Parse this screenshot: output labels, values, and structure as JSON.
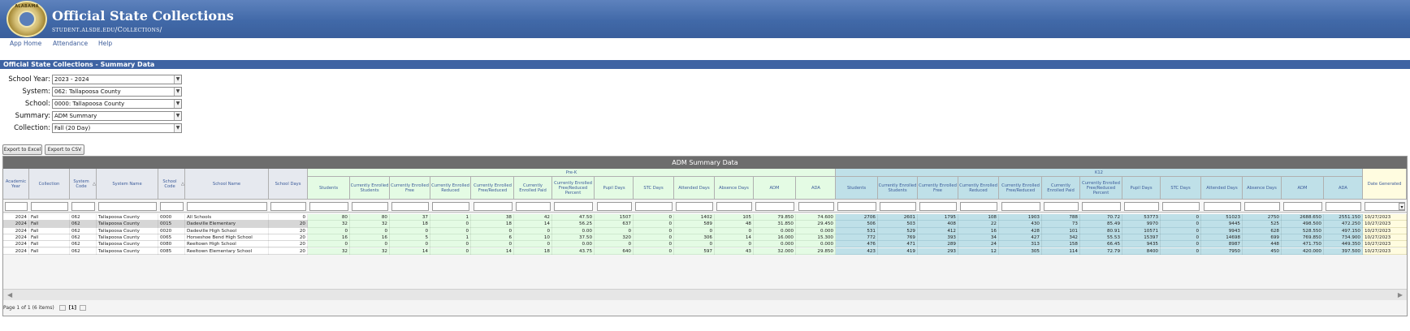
{
  "header": {
    "title": "Official State Collections",
    "subtitle": "student.alsde.edu/Collections/",
    "seal_text": "ALABAMA"
  },
  "nav": [
    "App Home",
    "Attendance",
    "Help"
  ],
  "section": {
    "title": "Official State Collections - Summary Data"
  },
  "filters": [
    {
      "label": "School Year:",
      "value": "2023 - 2024"
    },
    {
      "label": "System:",
      "value": "062: Tallapoosa County"
    },
    {
      "label": "School:",
      "value": "0000: Tallapoosa County"
    },
    {
      "label": "Summary:",
      "value": "ADM Summary"
    },
    {
      "label": "Collection:",
      "value": "Fall (20 Day)"
    }
  ],
  "buttons": {
    "export_excel": "Export to Excel",
    "export_csv": "Export to CSV"
  },
  "grid": {
    "title": "ADM Summary Data",
    "group_prek": "Pre-K",
    "group_k12": "K12",
    "fixed_headers": [
      "Academic Year",
      "Collection",
      "System Code",
      "System Name",
      "School Code",
      "School Name",
      "School Days"
    ],
    "metric_headers": [
      "Students",
      "Currently Enrolled Students",
      "Currently Enrolled Free",
      "Currently Enrolled Reduced",
      "Currently Enrolled Free/Reduced",
      "Currently Enrolled Paid",
      "Currently Enrolled Free/Reduced Percent",
      "Pupil Days",
      "STC Days",
      "Attended Days",
      "Absence Days",
      "ADM",
      "ADA"
    ],
    "last_header": "Date Generated",
    "rows": [
      {
        "year": "2024",
        "collection": "Fall",
        "sys_code": "062",
        "sys_name": "Tallapoosa County",
        "sch_code": "0000",
        "sch_name": "All Schools",
        "days": "0",
        "prek": [
          "80",
          "80",
          "37",
          "1",
          "38",
          "42",
          "47.50",
          "1507",
          "0",
          "1402",
          "105",
          "79.850",
          "74.600"
        ],
        "k12": [
          "2706",
          "2601",
          "1795",
          "108",
          "1903",
          "788",
          "70.72",
          "53773",
          "0",
          "51023",
          "2750",
          "2688.650",
          "2551.150"
        ],
        "date": "10/27/2023"
      },
      {
        "year": "2024",
        "collection": "Fall",
        "sys_code": "062",
        "sys_name": "Tallapoosa County",
        "sch_code": "0015",
        "sch_name": "Dadeville Elementary",
        "days": "20",
        "prek": [
          "32",
          "32",
          "18",
          "0",
          "18",
          "14",
          "56.25",
          "637",
          "0",
          "589",
          "48",
          "31.850",
          "29.450"
        ],
        "k12": [
          "506",
          "503",
          "408",
          "22",
          "430",
          "73",
          "85.49",
          "9970",
          "0",
          "9445",
          "525",
          "498.500",
          "472.250"
        ],
        "date": "10/27/2023"
      },
      {
        "year": "2024",
        "collection": "Fall",
        "sys_code": "062",
        "sys_name": "Tallapoosa County",
        "sch_code": "0020",
        "sch_name": "Dadeville High School",
        "days": "20",
        "prek": [
          "0",
          "0",
          "0",
          "0",
          "0",
          "0",
          "0.00",
          "0",
          "0",
          "0",
          "0",
          "0.000",
          "0.000"
        ],
        "k12": [
          "531",
          "529",
          "412",
          "16",
          "428",
          "101",
          "80.91",
          "10571",
          "0",
          "9943",
          "628",
          "528.550",
          "497.150"
        ],
        "date": "10/27/2023"
      },
      {
        "year": "2024",
        "collection": "Fall",
        "sys_code": "062",
        "sys_name": "Tallapoosa County",
        "sch_code": "0065",
        "sch_name": "Horseshoe Bend High School",
        "days": "20",
        "prek": [
          "16",
          "16",
          "5",
          "1",
          "6",
          "10",
          "37.50",
          "320",
          "0",
          "306",
          "14",
          "16.000",
          "15.300"
        ],
        "k12": [
          "772",
          "769",
          "393",
          "34",
          "427",
          "342",
          "55.53",
          "15397",
          "0",
          "14698",
          "699",
          "769.850",
          "734.900"
        ],
        "date": "10/27/2023"
      },
      {
        "year": "2024",
        "collection": "Fall",
        "sys_code": "062",
        "sys_name": "Tallapoosa County",
        "sch_code": "0080",
        "sch_name": "Reeltown High School",
        "days": "20",
        "prek": [
          "0",
          "0",
          "0",
          "0",
          "0",
          "0",
          "0.00",
          "0",
          "0",
          "0",
          "0",
          "0.000",
          "0.000"
        ],
        "k12": [
          "476",
          "471",
          "289",
          "24",
          "313",
          "158",
          "66.45",
          "9435",
          "0",
          "8987",
          "448",
          "471.750",
          "449.350"
        ],
        "date": "10/27/2023"
      },
      {
        "year": "2024",
        "collection": "Fall",
        "sys_code": "062",
        "sys_name": "Tallapoosa County",
        "sch_code": "0085",
        "sch_name": "Reeltown Elementary School",
        "days": "20",
        "prek": [
          "32",
          "32",
          "14",
          "0",
          "14",
          "18",
          "43.75",
          "640",
          "0",
          "597",
          "43",
          "32.000",
          "29.850"
        ],
        "k12": [
          "423",
          "419",
          "293",
          "12",
          "305",
          "114",
          "72.79",
          "8400",
          "0",
          "7950",
          "450",
          "420.000",
          "397.500"
        ],
        "date": "10/27/2023"
      }
    ],
    "pager": "Page 1 of 1 (6 items)",
    "page_current": "[1]"
  },
  "colors": {
    "banner": "#4169a8",
    "prek_bg": "#e4fbe4",
    "k12_bg": "#bfe0e8",
    "date_bg": "#fffce0",
    "header_text": "#3b5b9a"
  }
}
